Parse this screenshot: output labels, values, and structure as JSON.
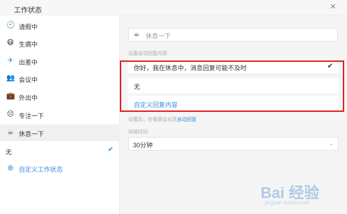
{
  "window": {
    "title": "工作状态"
  },
  "sidebar": {
    "items": [
      {
        "label": "请假中",
        "icon": "clock-icon"
      },
      {
        "label": "生病中",
        "icon": "sick-face-icon"
      },
      {
        "label": "出差中",
        "icon": "airplane-icon"
      },
      {
        "label": "会议中",
        "icon": "meeting-icon"
      },
      {
        "label": "外出中",
        "icon": "briefcase-icon"
      },
      {
        "label": "专注一下",
        "icon": "focus-face-icon"
      },
      {
        "label": "休息一下",
        "icon": "coffee-icon"
      }
    ],
    "active": "休息一下",
    "none_label": "无",
    "add_label": "自定义工作状态"
  },
  "main": {
    "status_value": "休息一下",
    "reply_section_label": "设置自动回复内容",
    "options": [
      "你好，我在休息中，消息回复可能不及时",
      "无",
      "自定义回复内容"
    ],
    "hint_prefix": "设置后，在看那会出现",
    "hint_link": "自动回复",
    "duration_label": "持续时间",
    "duration_value": "30分钟"
  },
  "watermark": {
    "main": "Bai 经验",
    "sub": "jingyan.baidu.com"
  },
  "colors": {
    "accent": "#3a8dde",
    "highlight_border": "#e02020",
    "main_bg": "#f5f5f5"
  }
}
